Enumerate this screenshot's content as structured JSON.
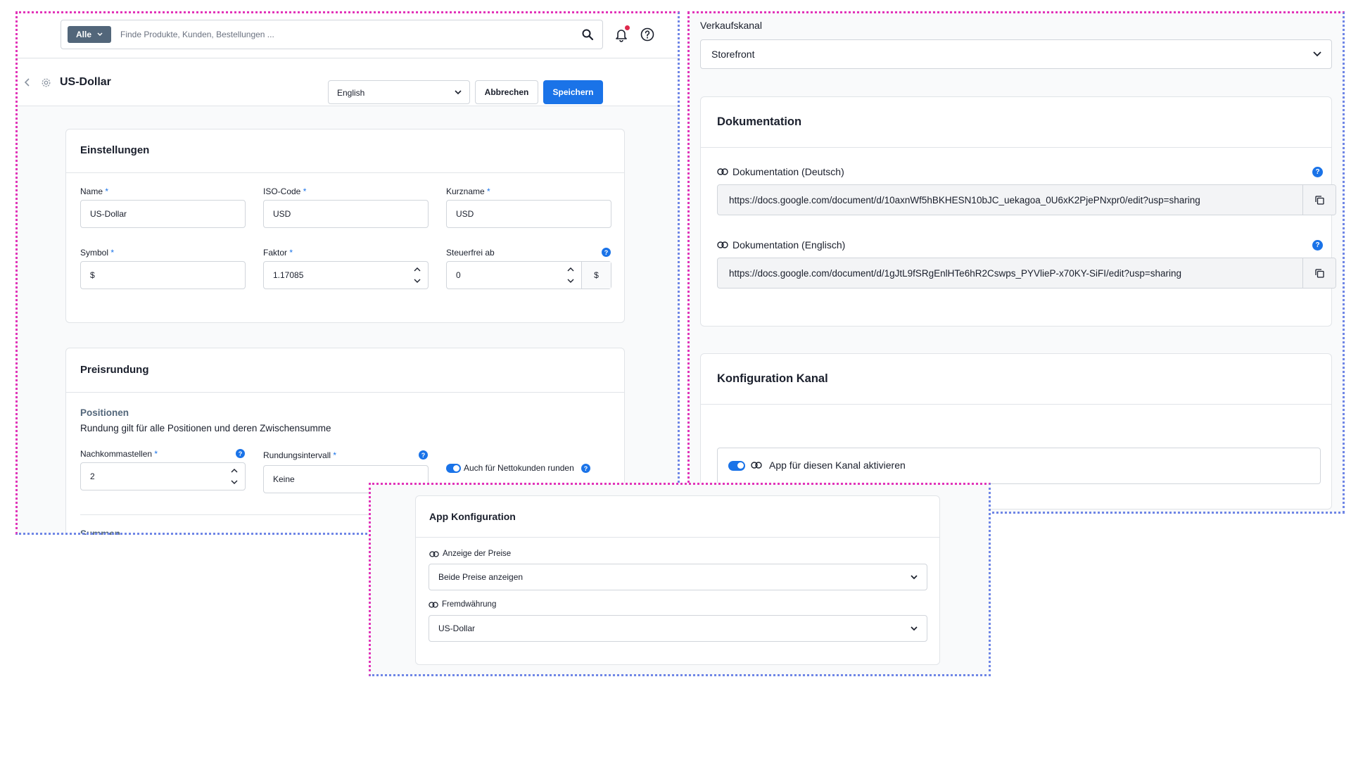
{
  "topbar": {
    "filter_label": "Alle",
    "search_placeholder": "Finde Produkte, Kunden, Bestellungen ..."
  },
  "pagebar": {
    "title": "US-Dollar",
    "language": "English",
    "cancel_label": "Abbrechen",
    "save_label": "Speichern"
  },
  "settings": {
    "title": "Einstellungen",
    "required_mark": "*",
    "name_label": "Name",
    "name_value": "US-Dollar",
    "iso_label": "ISO-Code",
    "iso_value": "USD",
    "short_label": "Kurzname",
    "short_value": "USD",
    "symbol_label": "Symbol",
    "symbol_value": "$",
    "factor_label": "Faktor",
    "factor_value": "1.17085",
    "taxfree_label": "Steuerfrei ab",
    "taxfree_value": "0",
    "taxfree_suffix": "$",
    "info_glyph": "?"
  },
  "rounding": {
    "title": "Preisrundung",
    "positions_title": "Positionen",
    "positions_desc": "Rundung gilt für alle Positionen und deren Zwischensumme",
    "decimals_label": "Nachkommastellen",
    "decimals_value": "2",
    "interval_label": "Rundungsintervall",
    "interval_value": "Keine",
    "net_toggle_label": "Auch für Nettokunden runden",
    "sums_title": "Summen"
  },
  "saleschannel": {
    "label": "Verkaufskanal",
    "value": "Storefront"
  },
  "documentation": {
    "title": "Dokumentation",
    "de_label": "Dokumentation (Deutsch)",
    "de_url": "https://docs.google.com/document/d/10axnWf5hBKHESN10bJC_uekagoa_0U6xK2PjePNxpr0/edit?usp=sharing",
    "en_label": "Dokumentation (Englisch)",
    "en_url": "https://docs.google.com/document/d/1gJtL9fSRgEnlHTe6hR2Cswps_PYVlieP-x70KY-SiFI/edit?usp=sharing"
  },
  "channel_config": {
    "title": "Konfiguration Kanal",
    "activate_label": "App für diesen Kanal aktivieren"
  },
  "app_config": {
    "title": "App Konfiguration",
    "price_display_label": "Anzeige der Preise",
    "price_display_value": "Beide Preise anzeigen",
    "currency_label": "Fremdwährung",
    "currency_value": "US-Dollar"
  },
  "colors": {
    "accent": "#1a73e8",
    "frame_pink": "#e234b9",
    "frame_blue": "#6f86e6",
    "filter_button": "#52667a",
    "notification_dot": "#de294c"
  },
  "icons": [
    "search-icon",
    "bell-icon",
    "help-icon",
    "back-icon",
    "settings-icon",
    "chevron-down-icon",
    "stepper-icon",
    "info-icon",
    "link-icon",
    "copy-icon",
    "toggle"
  ]
}
